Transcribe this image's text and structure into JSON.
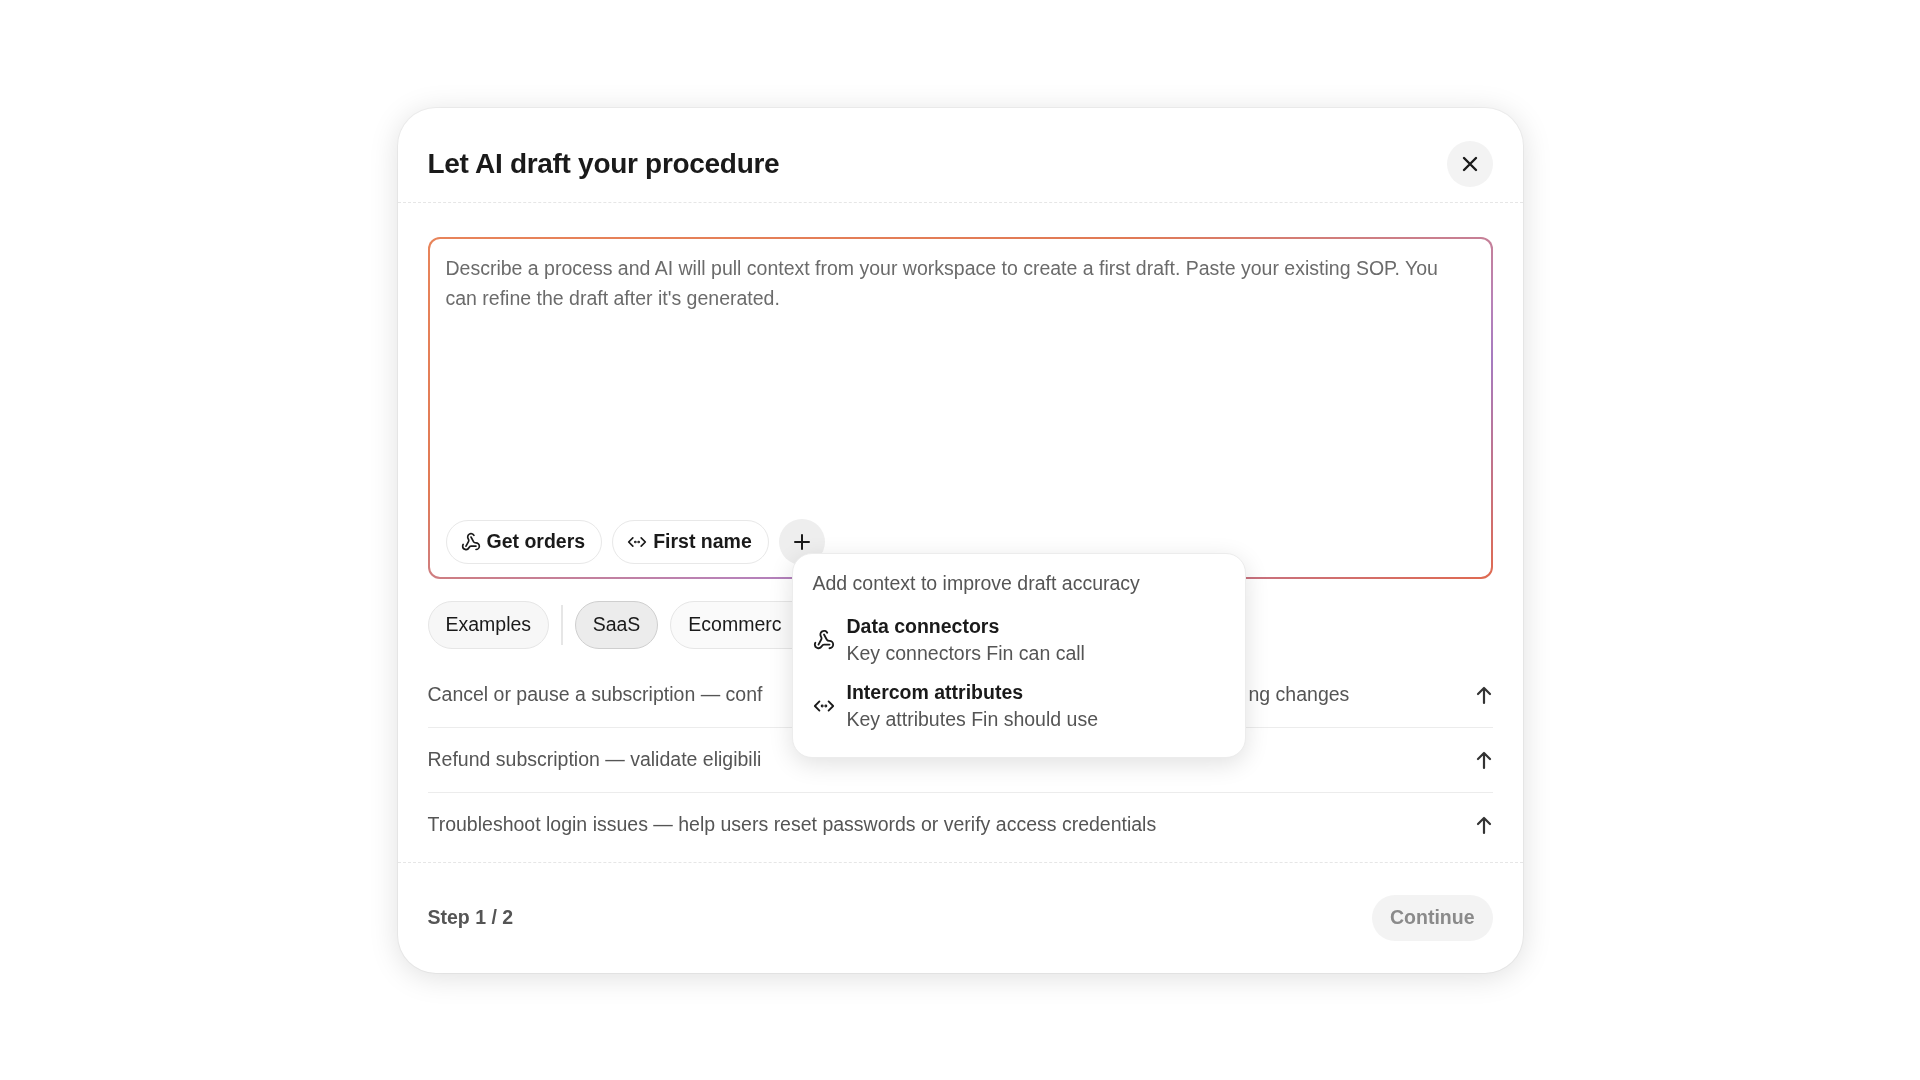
{
  "dialog": {
    "title": "Let AI draft your procedure",
    "prompt": {
      "placeholder": "Describe a process and AI will pull context from your workspace to create a first draft. Paste your existing SOP. You can refine the draft after it's generated."
    },
    "context_pills": [
      {
        "kind": "connector",
        "label": "Get orders"
      },
      {
        "kind": "attribute",
        "label": "First name"
      }
    ],
    "examples_label": "Examples",
    "categories": [
      {
        "label": "SaaS",
        "selected": true
      },
      {
        "label": "Ecommerc",
        "selected": false
      }
    ],
    "suggestions": [
      {
        "text_start": "Cancel or pause a subscription — conf",
        "text_end": "ng changes"
      },
      {
        "text_start": "Refund subscription — validate eligibili"
      },
      {
        "text_start": "Troubleshoot login issues — help users reset passwords or verify access credentials"
      }
    ],
    "context_menu": {
      "heading": "Add context to improve draft accuracy",
      "items": [
        {
          "kind": "connector",
          "title": "Data connectors",
          "description": "Key connectors Fin can call"
        },
        {
          "kind": "attribute",
          "title": "Intercom attributes",
          "description": "Key attributes Fin should use"
        }
      ]
    },
    "footer": {
      "step": "Step 1 / 2",
      "continue_button": {
        "label": "Continue",
        "disabled": true
      }
    }
  }
}
